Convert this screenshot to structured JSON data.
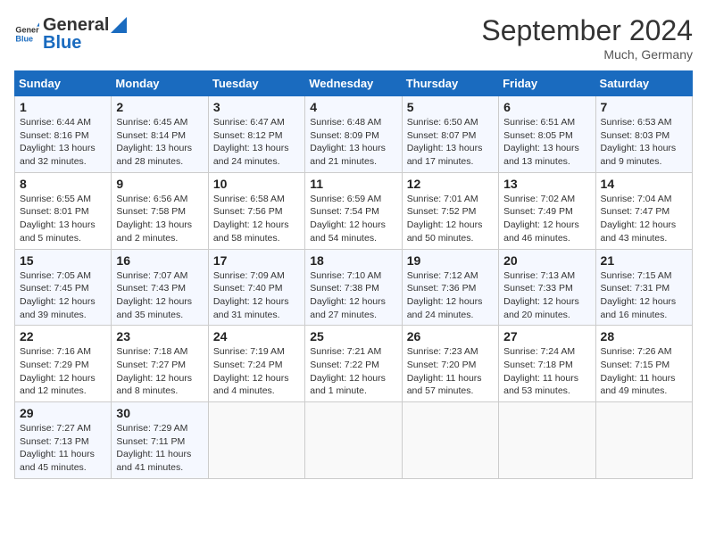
{
  "header": {
    "logo_general": "General",
    "logo_blue": "Blue",
    "title": "September 2024",
    "location": "Much, Germany"
  },
  "calendar": {
    "days_of_week": [
      "Sunday",
      "Monday",
      "Tuesday",
      "Wednesday",
      "Thursday",
      "Friday",
      "Saturday"
    ],
    "weeks": [
      [
        {
          "day": "1",
          "sunrise": "6:44 AM",
          "sunset": "8:16 PM",
          "daylight": "13 hours and 32 minutes."
        },
        {
          "day": "2",
          "sunrise": "6:45 AM",
          "sunset": "8:14 PM",
          "daylight": "13 hours and 28 minutes."
        },
        {
          "day": "3",
          "sunrise": "6:47 AM",
          "sunset": "8:12 PM",
          "daylight": "13 hours and 24 minutes."
        },
        {
          "day": "4",
          "sunrise": "6:48 AM",
          "sunset": "8:09 PM",
          "daylight": "13 hours and 21 minutes."
        },
        {
          "day": "5",
          "sunrise": "6:50 AM",
          "sunset": "8:07 PM",
          "daylight": "13 hours and 17 minutes."
        },
        {
          "day": "6",
          "sunrise": "6:51 AM",
          "sunset": "8:05 PM",
          "daylight": "13 hours and 13 minutes."
        },
        {
          "day": "7",
          "sunrise": "6:53 AM",
          "sunset": "8:03 PM",
          "daylight": "13 hours and 9 minutes."
        }
      ],
      [
        {
          "day": "8",
          "sunrise": "6:55 AM",
          "sunset": "8:01 PM",
          "daylight": "13 hours and 5 minutes."
        },
        {
          "day": "9",
          "sunrise": "6:56 AM",
          "sunset": "7:58 PM",
          "daylight": "13 hours and 2 minutes."
        },
        {
          "day": "10",
          "sunrise": "6:58 AM",
          "sunset": "7:56 PM",
          "daylight": "12 hours and 58 minutes."
        },
        {
          "day": "11",
          "sunrise": "6:59 AM",
          "sunset": "7:54 PM",
          "daylight": "12 hours and 54 minutes."
        },
        {
          "day": "12",
          "sunrise": "7:01 AM",
          "sunset": "7:52 PM",
          "daylight": "12 hours and 50 minutes."
        },
        {
          "day": "13",
          "sunrise": "7:02 AM",
          "sunset": "7:49 PM",
          "daylight": "12 hours and 46 minutes."
        },
        {
          "day": "14",
          "sunrise": "7:04 AM",
          "sunset": "7:47 PM",
          "daylight": "12 hours and 43 minutes."
        }
      ],
      [
        {
          "day": "15",
          "sunrise": "7:05 AM",
          "sunset": "7:45 PM",
          "daylight": "12 hours and 39 minutes."
        },
        {
          "day": "16",
          "sunrise": "7:07 AM",
          "sunset": "7:43 PM",
          "daylight": "12 hours and 35 minutes."
        },
        {
          "day": "17",
          "sunrise": "7:09 AM",
          "sunset": "7:40 PM",
          "daylight": "12 hours and 31 minutes."
        },
        {
          "day": "18",
          "sunrise": "7:10 AM",
          "sunset": "7:38 PM",
          "daylight": "12 hours and 27 minutes."
        },
        {
          "day": "19",
          "sunrise": "7:12 AM",
          "sunset": "7:36 PM",
          "daylight": "12 hours and 24 minutes."
        },
        {
          "day": "20",
          "sunrise": "7:13 AM",
          "sunset": "7:33 PM",
          "daylight": "12 hours and 20 minutes."
        },
        {
          "day": "21",
          "sunrise": "7:15 AM",
          "sunset": "7:31 PM",
          "daylight": "12 hours and 16 minutes."
        }
      ],
      [
        {
          "day": "22",
          "sunrise": "7:16 AM",
          "sunset": "7:29 PM",
          "daylight": "12 hours and 12 minutes."
        },
        {
          "day": "23",
          "sunrise": "7:18 AM",
          "sunset": "7:27 PM",
          "daylight": "12 hours and 8 minutes."
        },
        {
          "day": "24",
          "sunrise": "7:19 AM",
          "sunset": "7:24 PM",
          "daylight": "12 hours and 4 minutes."
        },
        {
          "day": "25",
          "sunrise": "7:21 AM",
          "sunset": "7:22 PM",
          "daylight": "12 hours and 1 minute."
        },
        {
          "day": "26",
          "sunrise": "7:23 AM",
          "sunset": "7:20 PM",
          "daylight": "11 hours and 57 minutes."
        },
        {
          "day": "27",
          "sunrise": "7:24 AM",
          "sunset": "7:18 PM",
          "daylight": "11 hours and 53 minutes."
        },
        {
          "day": "28",
          "sunrise": "7:26 AM",
          "sunset": "7:15 PM",
          "daylight": "11 hours and 49 minutes."
        }
      ],
      [
        {
          "day": "29",
          "sunrise": "7:27 AM",
          "sunset": "7:13 PM",
          "daylight": "11 hours and 45 minutes."
        },
        {
          "day": "30",
          "sunrise": "7:29 AM",
          "sunset": "7:11 PM",
          "daylight": "11 hours and 41 minutes."
        },
        null,
        null,
        null,
        null,
        null
      ]
    ]
  }
}
